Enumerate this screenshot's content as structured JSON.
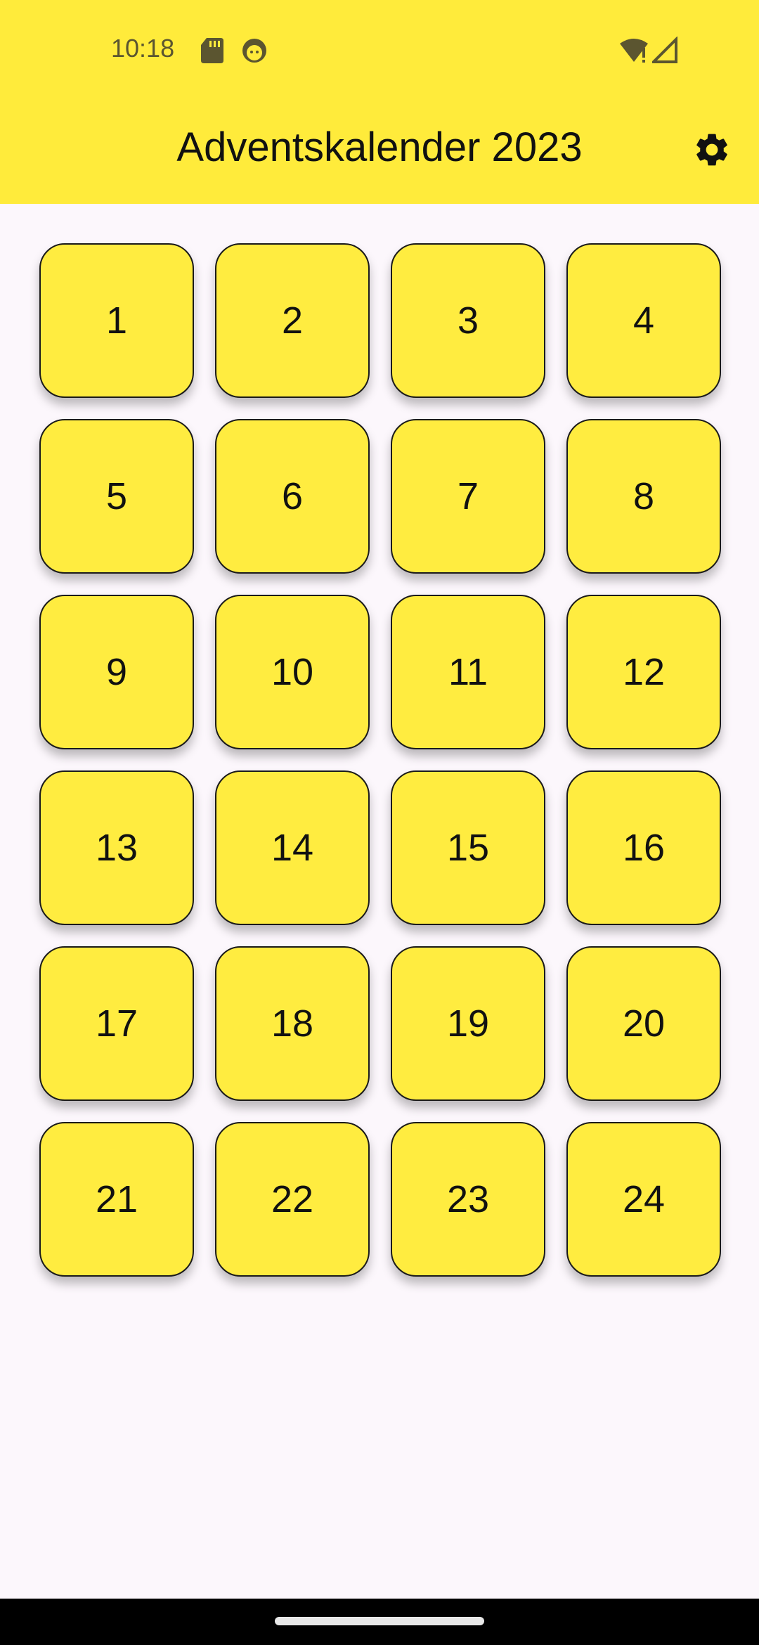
{
  "status_bar": {
    "time": "10:18",
    "icons": [
      "sd-card-icon",
      "notification-face-icon",
      "wifi-alert-icon",
      "cell-signal-icon"
    ]
  },
  "toolbar": {
    "title": "Adventskalender 2023",
    "settings_icon": "gear-icon"
  },
  "calendar": {
    "doors": [
      "1",
      "2",
      "3",
      "4",
      "5",
      "6",
      "7",
      "8",
      "9",
      "10",
      "11",
      "12",
      "13",
      "14",
      "15",
      "16",
      "17",
      "18",
      "19",
      "20",
      "21",
      "22",
      "23",
      "24"
    ]
  },
  "colors": {
    "accent": "#FFEB3B",
    "door_fill": "#FFEC40",
    "background": "#FCF7FC",
    "text": "#111111"
  }
}
